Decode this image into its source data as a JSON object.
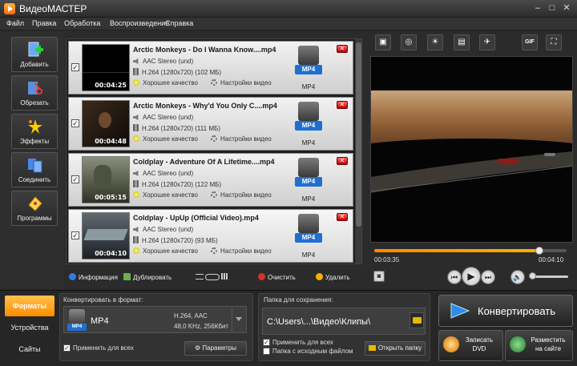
{
  "app": {
    "title": "ВидеоМАСТЕР"
  },
  "menu": [
    "Файл",
    "Правка",
    "Обработка",
    "Воспроизведение",
    "Справка"
  ],
  "tools": [
    {
      "label": "Добавить",
      "icon": "add-file-icon"
    },
    {
      "label": "Обрезать",
      "icon": "scissors-icon"
    },
    {
      "label": "Эффекты",
      "icon": "effects-icon"
    },
    {
      "label": "Соединить",
      "icon": "join-icon"
    },
    {
      "label": "Программы",
      "icon": "programs-icon"
    }
  ],
  "files": [
    {
      "name": "Arctic Monkeys - Do I Wanna Know....mp4",
      "audio": "AAC Stereo (und)",
      "video": "H.264 (1280x720) (102 МБ)",
      "quality": "Хорошее качество",
      "settings": "Настройки видео",
      "duration": "00:04:25",
      "format": "MP4",
      "checked": "✓"
    },
    {
      "name": "Arctic Monkeys - Why'd You Only C....mp4",
      "audio": "AAC Stereo (und)",
      "video": "H.264 (1280x720) (111 МБ)",
      "quality": "Хорошее качество",
      "settings": "Настройки видео",
      "duration": "00:04:48",
      "format": "MP4",
      "checked": "✓"
    },
    {
      "name": "Coldplay - Adventure Of A Lifetime....mp4",
      "audio": "AAC Stereo (und)",
      "video": "H.264 (1280x720) (122 МБ)",
      "quality": "Хорошее качество",
      "settings": "Настройки видео",
      "duration": "00:05:15",
      "format": "MP4",
      "checked": "✓"
    },
    {
      "name": "Coldplay - UpUp (Official Video).mp4",
      "audio": "AAC Stereo (und)",
      "video": "H.264 (1280x720) (93 МБ)",
      "quality": "Хорошее качество",
      "settings": "Настройки видео",
      "duration": "00:04:10",
      "format": "MP4",
      "checked": "✓"
    }
  ],
  "list_toolbar": {
    "info": "Информация",
    "duplicate": "Дублировать",
    "clear": "Очистить",
    "delete": "Удалить"
  },
  "preview_toolbar": [
    "crop-icon",
    "rotate-icon",
    "brightness-icon",
    "frame-icon",
    "speed-icon",
    "gif-icon",
    "fullscreen-icon"
  ],
  "preview_toolbar_gif": "GIF",
  "player": {
    "current_time": "00:03:35",
    "total_time": "00:04:10",
    "progress": 0.86
  },
  "bottom_tabs": [
    "Форматы",
    "Устройства",
    "Сайты"
  ],
  "convert": {
    "title": "Конвертировать в формат:",
    "format": "MP4",
    "format_tag": "MP4",
    "spec_video": "H.264, AAC",
    "spec_audio": "48,0 KHz, 256Кбит",
    "apply_all": "Применить для всех",
    "params_button": "Параметры"
  },
  "folder": {
    "title": "Папка для сохранения:",
    "path": "C:\\Users\\...\\Видео\\Клипы\\",
    "apply_all": "Применить для всех",
    "source_folder": "Папка с исходным файлом",
    "open_button": "Открыть папку"
  },
  "actions": {
    "convert": "Конвертировать",
    "dvd_line1": "Записать",
    "dvd_line2": "DVD",
    "site_line1": "Разместить",
    "site_line2": "на сайте"
  },
  "colors": {
    "accent": "#ff9900",
    "format_blue": "#1f6fd1",
    "remove_red": "#cc0000"
  }
}
